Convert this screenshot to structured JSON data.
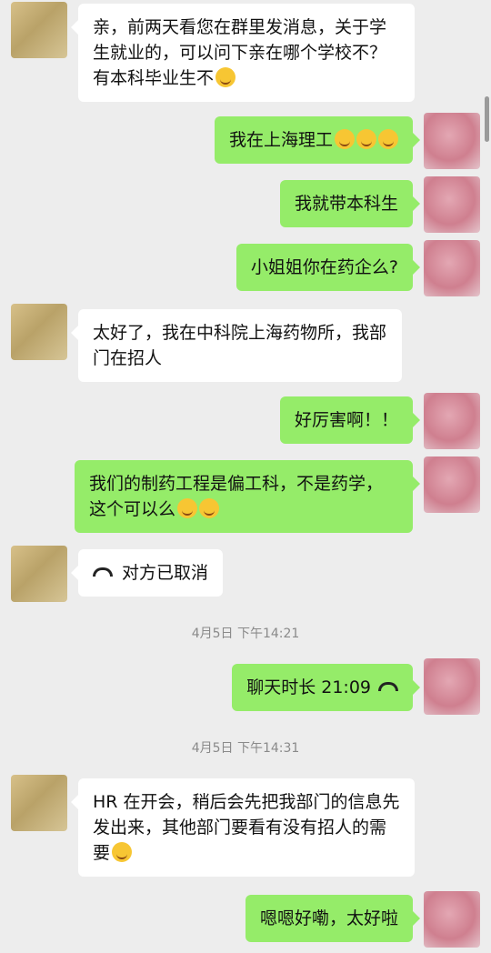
{
  "messages": [
    {
      "side": "left",
      "text": "亲，前两天看您在群里发消息，关于学生就业的，可以问下亲在哪个学校不？有本科毕业生不",
      "emoji": "smile-emoji"
    },
    {
      "side": "right",
      "text": "我在上海理工",
      "emoji": "thinking-emoji"
    },
    {
      "side": "right",
      "text": "我就带本科生"
    },
    {
      "side": "right",
      "text": "小姐姐你在药企么?"
    },
    {
      "side": "left",
      "text": "太好了，我在中科院上海药物所，我部门在招人"
    },
    {
      "side": "right",
      "text": "好厉害啊！！"
    },
    {
      "side": "right",
      "text": "我们的制药工程是偏工科，不是药学，这个可以么",
      "emoji": "laugh-cry-emoji"
    },
    {
      "side": "left",
      "text": "对方已取消",
      "icon": "phone-hangup-icon"
    },
    {
      "side": "right",
      "text": "聊天时长 21:09",
      "icon": "phone-hangup-icon"
    },
    {
      "side": "left",
      "text": "HR 在开会，稍后会先把我部门的信息先发出来，其他部门要看有没有招人的需要",
      "emoji": "smile-emoji"
    },
    {
      "side": "right",
      "text": "嗯嗯好嘞，太好啦"
    }
  ],
  "timestamps": [
    "4月5日 下午14:21",
    "4月5日 下午14:31"
  ]
}
